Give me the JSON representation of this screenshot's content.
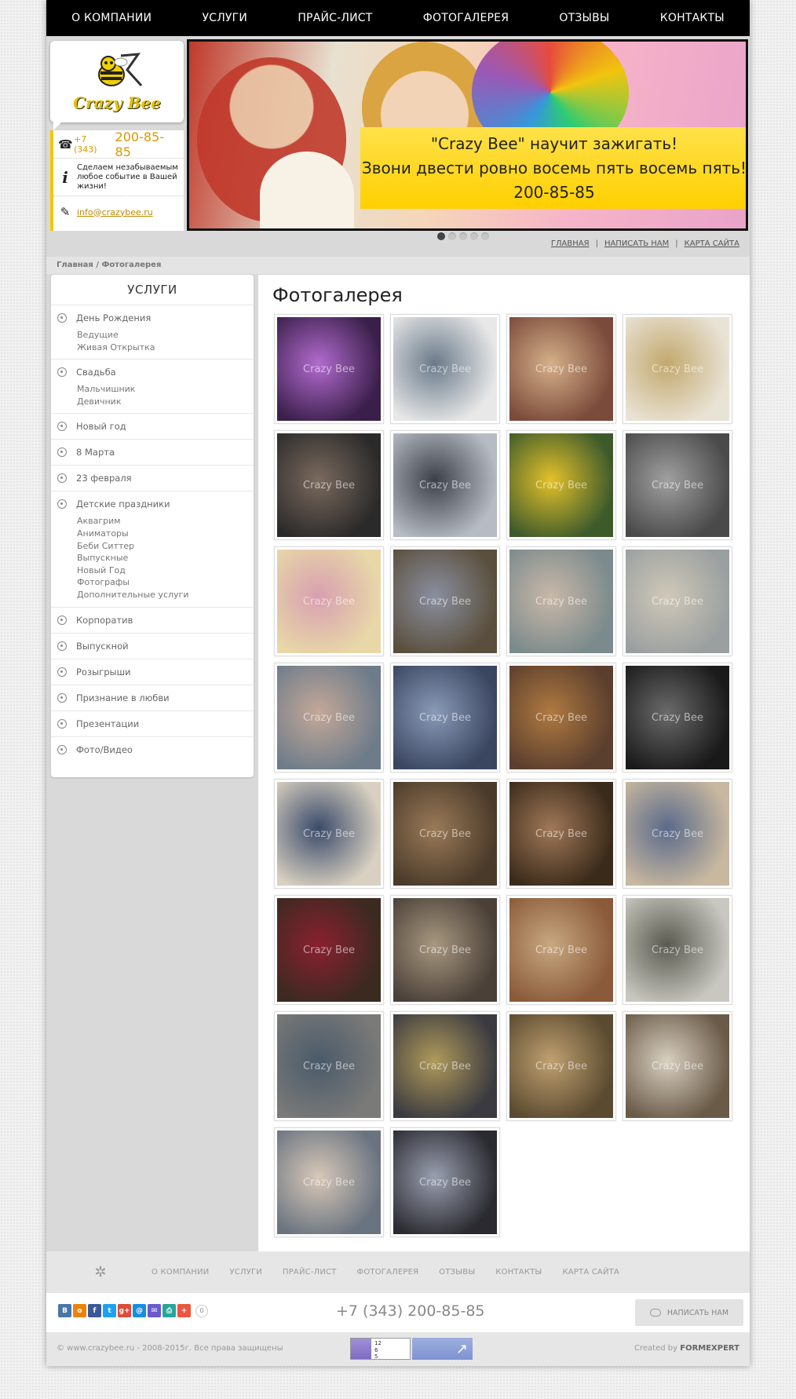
{
  "nav": [
    "О КОМПАНИИ",
    "УСЛУГИ",
    "ПРАЙС-ЛИСТ",
    "ФОТОГАЛЕРЕЯ",
    "ОТЗЫВЫ",
    "КОНТАКТЫ"
  ],
  "logo_text": "Crazy Bee",
  "contact": {
    "phone_code": "+7 (343)",
    "phone_number": "200-85-85",
    "info": "Сделаем незабываемым любое событие в Вашей жизни!",
    "email": "info@crazybee.ru"
  },
  "banner": {
    "line1": "\"Crazy Bee\" научит зажигать!",
    "line2": "Звони двести ровно восемь пять восемь пять!",
    "line3": "200-85-85",
    "slides": 5,
    "active_slide": 1
  },
  "toplinks": [
    "ГЛАВНАЯ",
    "НАПИСАТЬ НАМ",
    "КАРТА САЙТА"
  ],
  "toplinks_sep": "|",
  "breadcrumb": "Главная / Фотогалерея",
  "sidebar": {
    "title": "УСЛУГИ",
    "items": [
      {
        "label": "День Рождения",
        "sub": [
          "Ведущие",
          "Живая Открытка"
        ]
      },
      {
        "label": "Свадьба",
        "sub": [
          "Мальчишник",
          "Девичник"
        ]
      },
      {
        "label": "Новый год",
        "sub": []
      },
      {
        "label": "8 Марта",
        "sub": []
      },
      {
        "label": "23 февраля",
        "sub": []
      },
      {
        "label": "Детские праздники",
        "sub": [
          "Аквагрим",
          "Аниматоры",
          "Беби Ситтер",
          "Выпускные",
          "Новый Год",
          "Фотографы",
          "Дополнительные услуги"
        ]
      },
      {
        "label": "Корпоратив",
        "sub": []
      },
      {
        "label": "Выпускной",
        "sub": []
      },
      {
        "label": "Розыгрыши",
        "sub": []
      },
      {
        "label": "Признание в любви",
        "sub": []
      },
      {
        "label": "Презентации",
        "sub": []
      },
      {
        "label": "Фото/Видео",
        "sub": []
      }
    ]
  },
  "content": {
    "title": "Фотогалерея",
    "watermark": "Crazy Bee",
    "photo_colors": [
      [
        "#3a1f4a",
        "#b36bd0"
      ],
      [
        "#e8e8e8",
        "#6a7a8a"
      ],
      [
        "#7a4a3a",
        "#d6b08a"
      ],
      [
        "#e9e3d6",
        "#c2a86d"
      ],
      [
        "#2b2a2a",
        "#7a6a5e"
      ],
      [
        "#b7bcc4",
        "#3c4048"
      ],
      [
        "#3d5a2b",
        "#e4c12a"
      ],
      [
        "#4a4a4a",
        "#a0a0a0"
      ],
      [
        "#e8d8a8",
        "#d89fb0"
      ],
      [
        "#5a4f3c",
        "#8a8fa0"
      ],
      [
        "#7b8a8c",
        "#c9b8a8"
      ],
      [
        "#9aa0a0",
        "#cfc8b8"
      ],
      [
        "#6e7c8a",
        "#c4a898"
      ],
      [
        "#3a4660",
        "#8a9ab8"
      ],
      [
        "#5a3e2e",
        "#b07a40"
      ],
      [
        "#1a1a1a",
        "#6a6a6a"
      ],
      [
        "#d8d0c0",
        "#3a4a6a"
      ],
      [
        "#4a3a2a",
        "#9a7a58"
      ],
      [
        "#3a2a1a",
        "#a07858"
      ],
      [
        "#c8b8a0",
        "#5a6a8a"
      ],
      [
        "#3a2a20",
        "#8a2030"
      ],
      [
        "#4a4038",
        "#a89880"
      ],
      [
        "#8a5a3a",
        "#c8a880"
      ],
      [
        "#c8c8c0",
        "#5a5a50"
      ],
      [
        "#7a7a78",
        "#4a5a6a"
      ],
      [
        "#3a3a40",
        "#b09a5a"
      ],
      [
        "#5a4a30",
        "#c0a070"
      ],
      [
        "#6a5a48",
        "#d8d0c0"
      ],
      [
        "#6a7480",
        "#d8c8b8"
      ],
      [
        "#2a2a30",
        "#9aa0b0"
      ]
    ]
  },
  "footer": {
    "nav": [
      "О КОМПАНИИ",
      "УСЛУГИ",
      "ПРАЙС-ЛИСТ",
      "ФОТОГАЛЕРЕЯ",
      "ОТЗЫВЫ",
      "КОНТАКТЫ",
      "КАРТА САЙТА"
    ],
    "share_buttons": [
      {
        "letter": "В",
        "color": "#4a76a8"
      },
      {
        "letter": "о",
        "color": "#ee8208"
      },
      {
        "letter": "f",
        "color": "#3b5998"
      },
      {
        "letter": "t",
        "color": "#1da1f2"
      },
      {
        "letter": "g+",
        "color": "#dd4b39"
      },
      {
        "letter": "@",
        "color": "#168de2"
      },
      {
        "letter": "✉",
        "color": "#6a5acd"
      },
      {
        "letter": "⎙",
        "color": "#26a69a"
      },
      {
        "letter": "+",
        "color": "#e9573f"
      }
    ],
    "share_count": "0",
    "phone": "+7 (343) 200-85-85",
    "write_button": "НАПИСАТЬ НАМ",
    "copyright": "© www.crazybee.ru - 2008-2015г. Все права защищены",
    "counter_nums": [
      "12",
      "6",
      "5"
    ],
    "created_by": "Created by",
    "creator": "FORMEXPERT"
  },
  "colors": {
    "accent": "#ffd000",
    "phone": "#d79a00",
    "nav_bg": "#000000"
  }
}
